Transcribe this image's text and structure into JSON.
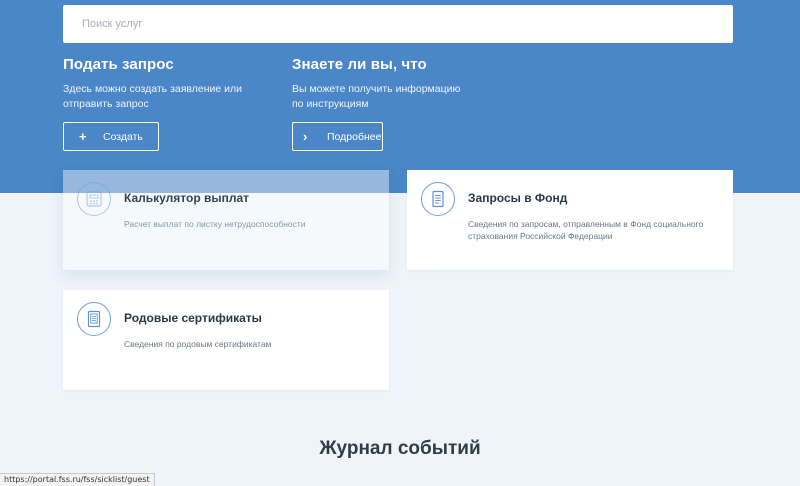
{
  "search": {
    "placeholder": "Поиск услуг"
  },
  "request_block": {
    "title": "Подать запрос",
    "description": "Здесь можно создать заявление или отправить запрос",
    "button_label": "Создать"
  },
  "info_block": {
    "title": "Знаете ли вы, что",
    "description": "Вы можете получить информацию по инструкциям",
    "button_label": "Подробнее"
  },
  "cards": [
    {
      "title": "Калькулятор выплат",
      "description": "Расчет выплат по листку нетрудоспособности",
      "icon": "calculator-icon"
    },
    {
      "title": "Запросы в Фонд",
      "description": "Сведения по запросам, отправленным в Фонд социального страхования Российской Федерации",
      "icon": "document-icon"
    },
    {
      "title": "Родовые сертификаты",
      "description": "Сведения по родовым сертификатам",
      "icon": "certificate-icon"
    }
  ],
  "events": {
    "title": "Журнал событий"
  },
  "status_url": "https://portal.fss.ru/fss/sicklist/guest",
  "colors": {
    "hero_bg": "#4a86c8",
    "page_bg": "#eff4fa",
    "icon_stroke": "#6d9fd6"
  }
}
